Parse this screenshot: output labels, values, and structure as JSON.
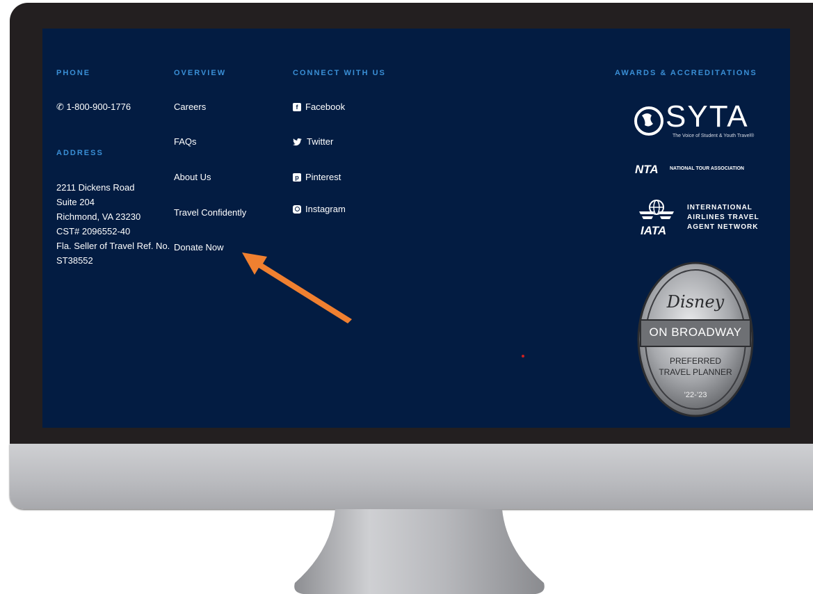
{
  "footer": {
    "phone": {
      "heading": "PHONE",
      "number": "1-800-900-1776"
    },
    "address": {
      "heading": "ADDRESS",
      "lines": [
        "2211 Dickens Road",
        "Suite 204",
        "Richmond, VA 23230",
        "CST# 2096552-40",
        "Fla. Seller of Travel Ref. No.",
        "ST38552"
      ]
    },
    "overview": {
      "heading": "OVERVIEW",
      "links": [
        "Careers",
        "FAQs",
        "About Us",
        "Travel Confidently",
        "Donate Now"
      ]
    },
    "connect": {
      "heading": "CONNECT WITH US",
      "links": [
        {
          "label": "Facebook",
          "icon": "facebook-icon"
        },
        {
          "label": "Twitter",
          "icon": "twitter-icon"
        },
        {
          "label": "Pinterest",
          "icon": "pinterest-icon"
        },
        {
          "label": "Instagram",
          "icon": "instagram-icon"
        }
      ]
    },
    "awards": {
      "heading": "AWARDS & ACCREDITATIONS",
      "syta": {
        "name": "SYTA",
        "tagline": "The Voice of Student & Youth Travel®"
      },
      "nta": {
        "name": "NTA",
        "tagline": "NATIONAL TOUR ASSOCIATION"
      },
      "iata": {
        "name": "IATA",
        "line1": "INTERNATIONAL",
        "line2": "AIRLINES TRAVEL",
        "line3": "AGENT NETWORK"
      },
      "disney": {
        "brand": "Disney",
        "line1": "ON BROADWAY",
        "line2": "PREFERRED",
        "line3": "TRAVEL PLANNER",
        "years": "’22-’23"
      }
    }
  },
  "colors": {
    "background": "#031c42",
    "heading": "#3a8fd6",
    "arrow": "#f08030"
  },
  "annotation": {
    "arrow": "arrow pointing to Donate Now"
  }
}
